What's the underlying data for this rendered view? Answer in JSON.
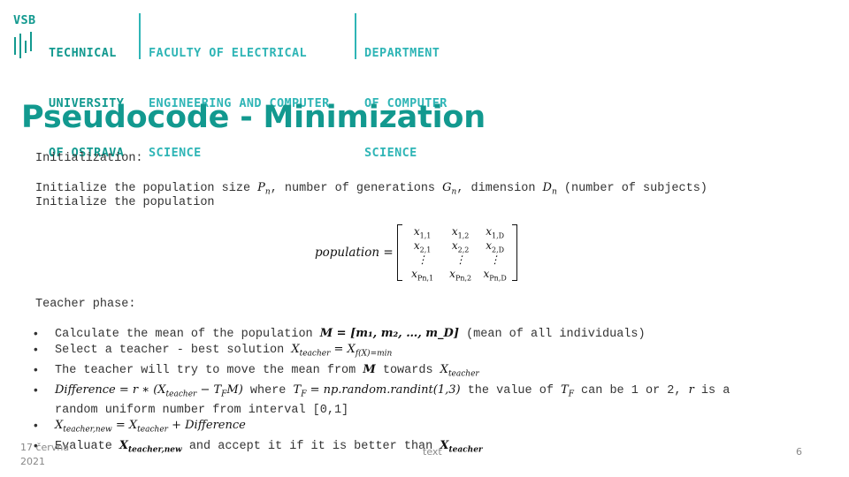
{
  "header": {
    "logo": {
      "vsb": "VSB",
      "university_lines": [
        "TECHNICAL",
        "UNIVERSITY",
        "OF OSTRAVA"
      ],
      "faculty_lines": [
        "FACULTY OF ELECTRICAL",
        "ENGINEERING AND COMPUTER",
        "SCIENCE"
      ],
      "department_lines": [
        "DEPARTMENT",
        "OF COMPUTER",
        "SCIENCE"
      ]
    },
    "colors": {
      "primary": "#12998f",
      "secondary": "#2fb5b6"
    }
  },
  "title": "Pseudocode - Minimization",
  "initialization": {
    "heading": "Initialization:",
    "line1_a": "Initialize the population size ",
    "line1_Pn": "P",
    "line1_Pn_sub": "n",
    "line1_b": ", number of generations ",
    "line1_Gn": "G",
    "line1_Gn_sub": "n",
    "line1_c": ", dimension ",
    "line1_Dn": "D",
    "line1_Dn_sub": "n",
    "line1_d": " (number of subjects)",
    "line2": "Initialize the population"
  },
  "matrix": {
    "label": "population =",
    "rows": [
      [
        {
          "base": "x",
          "sub": "1,1"
        },
        {
          "base": "x",
          "sub": "1,2"
        },
        {
          "base": "x",
          "sub": "1,D"
        }
      ],
      [
        {
          "base": "x",
          "sub": "2,1"
        },
        {
          "base": "x",
          "sub": "2,2"
        },
        {
          "base": "x",
          "sub": "2,D"
        }
      ],
      [
        {
          "base": "⋮",
          "sub": ""
        },
        {
          "base": "⋮",
          "sub": ""
        },
        {
          "base": "⋮",
          "sub": ""
        }
      ],
      [
        {
          "base": "x",
          "sub": "Pn,1"
        },
        {
          "base": "x",
          "sub": "Pn,2"
        },
        {
          "base": "x",
          "sub": "Pn,D"
        }
      ]
    ]
  },
  "teacher_phase": {
    "heading": "Teacher phase:",
    "b1_a": "Calculate the mean of the population ",
    "b1_math": "M = [m₁, m₂, …, m_D]",
    "b1_b": " (mean of all individuals)",
    "b2_a": "Select a teacher - best solution ",
    "b2_math_lhs": "X",
    "b2_math_lhs_sub": "teacher",
    "b2_math_rhs": " = X",
    "b2_math_rhs_sub": "f(X)=min",
    "b3_a": "The teacher will try to move the mean from ",
    "b3_M": "M",
    "b3_b": " towards ",
    "b3_X": "X",
    "b3_X_sub": "teacher",
    "b4_math1": "Difference = r ∗ (X",
    "b4_math1_sub": "teacher",
    "b4_math1_end": " − T",
    "b4_math1_TF_sub": "F",
    "b4_math1_close": "M)",
    "b4_a": " where ",
    "b4_math2": "T",
    "b4_math2_sub": "F",
    "b4_math2_rest": " = np.random.randint(1,3)",
    "b4_b": " the value of ",
    "b4_TF": "T",
    "b4_TF_sub": "F",
    "b4_c": " can be 1 or 2, ",
    "b4_r": "r",
    "b4_d": " is a",
    "b4_cont": "random uniform number from interval [0,1]",
    "b5_lhs": "X",
    "b5_lhs_sub": "teacher,new",
    "b5_mid": " = X",
    "b5_mid_sub": "teacher",
    "b5_rhs": " + Difference",
    "b6_a": "Evaluate ",
    "b6_X": "X",
    "b6_X_sub": "teacher,new",
    "b6_b": " and accept it if it is better than ",
    "b6_X2": "X",
    "b6_X2_sub": "teacher"
  },
  "footer": {
    "date_line1": "17 června",
    "date_line2": "2021",
    "center_text": "text",
    "page_number": "6"
  }
}
